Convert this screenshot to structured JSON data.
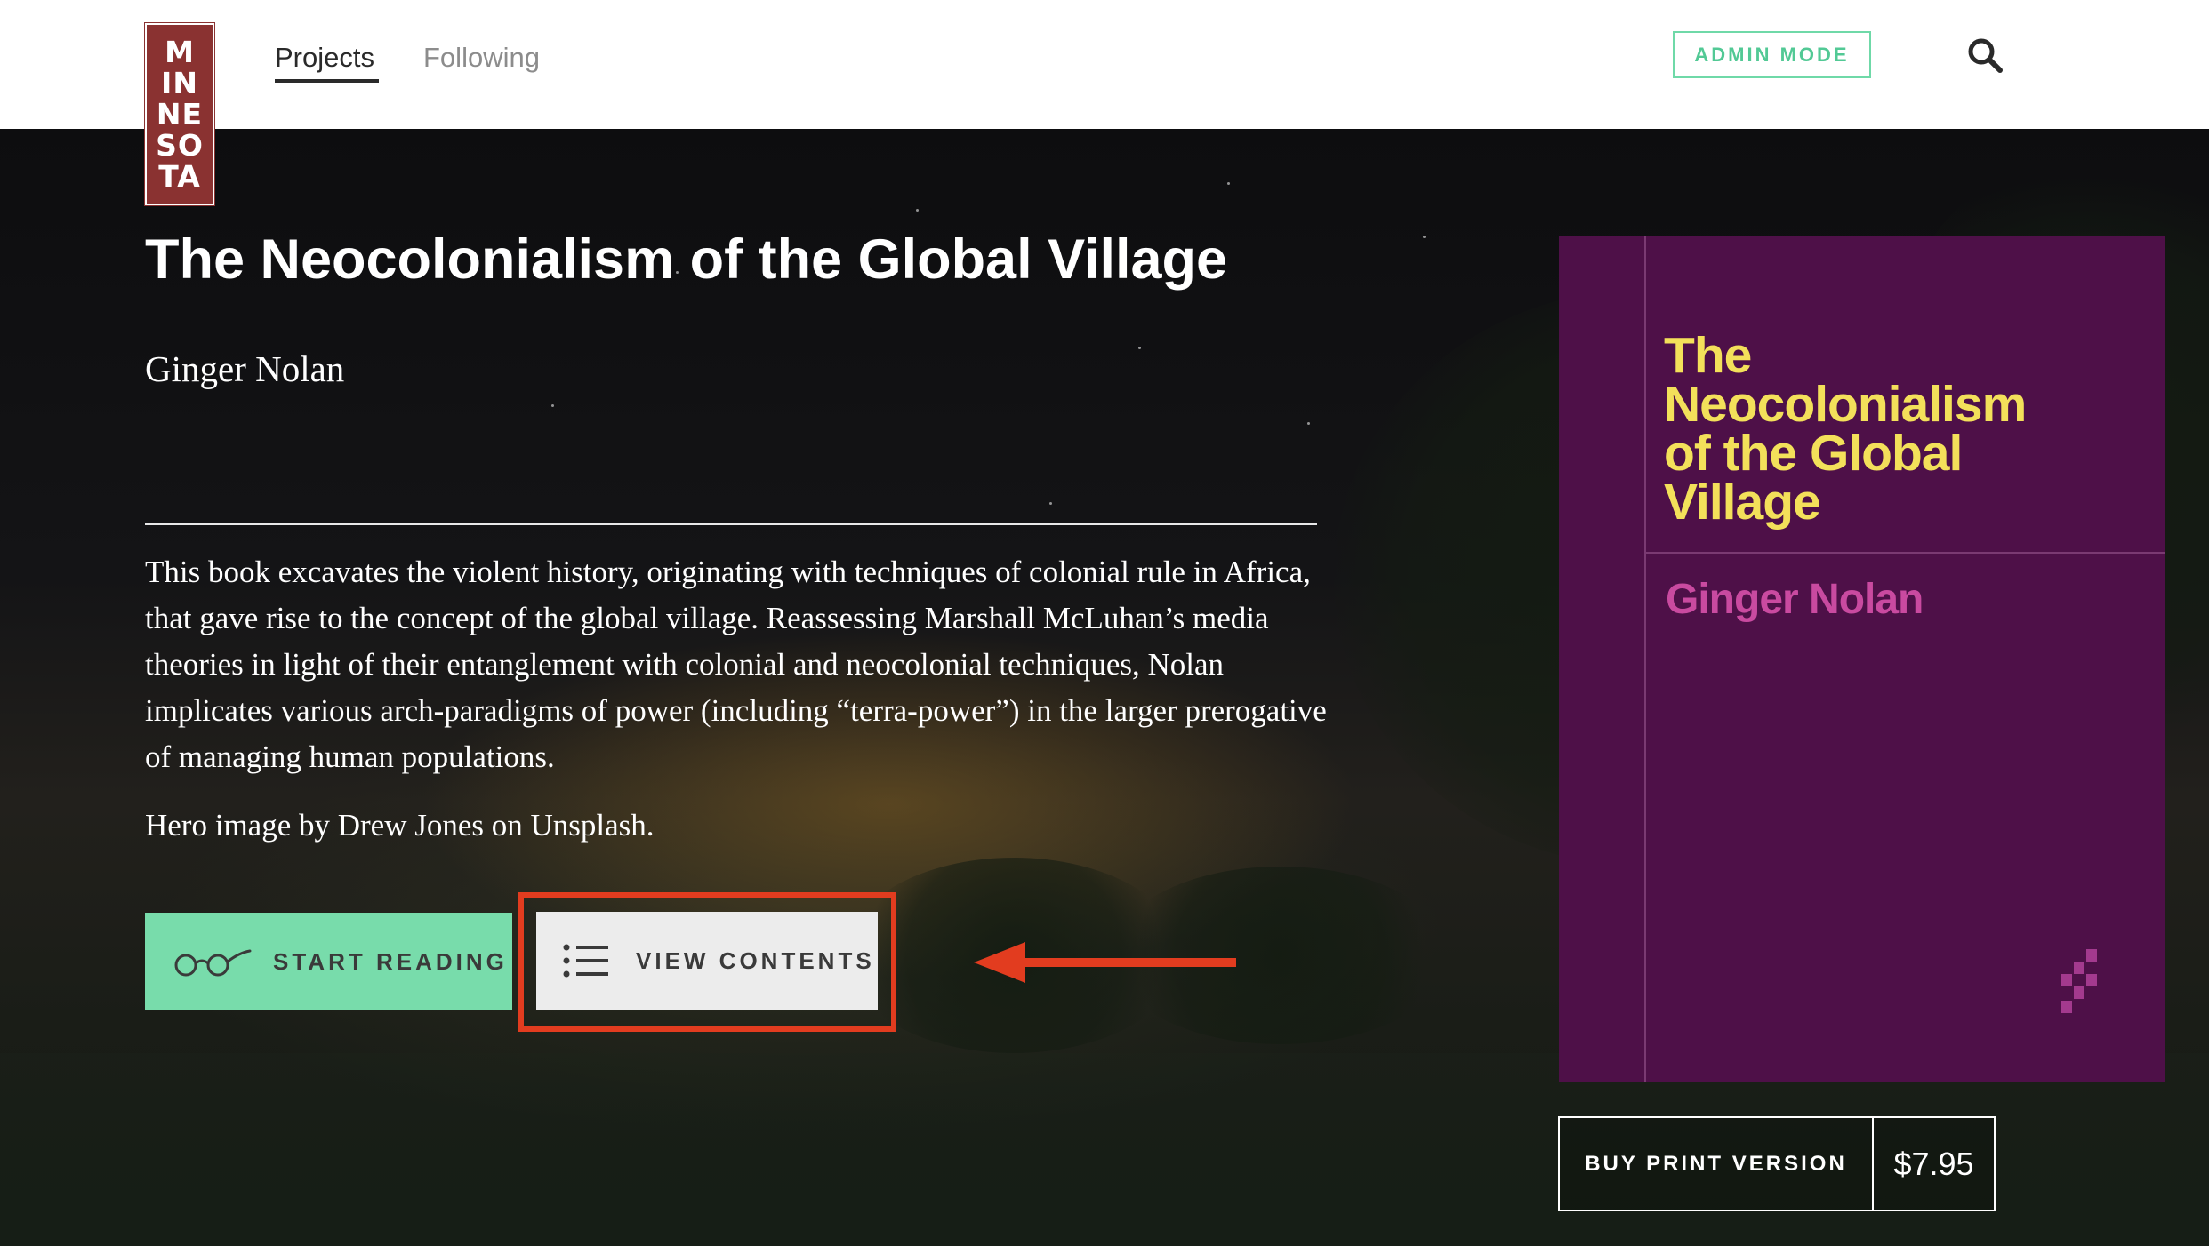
{
  "header": {
    "logo_lines": [
      "M",
      "IN",
      "NE",
      "SO",
      "TA"
    ],
    "nav": [
      {
        "label": "Projects",
        "active": true
      },
      {
        "label": "Following",
        "active": false
      }
    ],
    "admin_mode_label": "ADMIN MODE",
    "search_icon": "search-icon"
  },
  "project": {
    "title": "The Neocolonialism of the Global Village",
    "author": "Ginger Nolan",
    "description": "This book excavates the violent history, originating with techniques of colonial rule in Africa, that gave rise to the concept of the global village. Reassessing Marshall McLuhan’s media theories in light of their entanglement with colonial and neocolonial techniques, Nolan implicates various arch-paradigms of power (including “terra-power”) in the larger prerogative of managing human populations.",
    "credit": "Hero image by Drew Jones on Unsplash."
  },
  "actions": {
    "start_reading_label": "START READING",
    "start_reading_icon": "glasses-icon",
    "view_contents_label": "VIEW CONTENTS",
    "view_contents_icon": "list-icon"
  },
  "cover": {
    "title_lines": [
      "The",
      "Neocolonialism",
      "of the Global",
      "Village"
    ],
    "author": "Ginger Nolan",
    "background_color": "#4e1048",
    "title_color": "#f3e05a",
    "author_color": "#c94aa0"
  },
  "buy": {
    "label": "BUY PRINT VERSION",
    "price": "$7.95"
  },
  "colors": {
    "accent_green": "#78dcab",
    "highlight_red": "#e23c1f",
    "logo_red": "#8a3231"
  }
}
